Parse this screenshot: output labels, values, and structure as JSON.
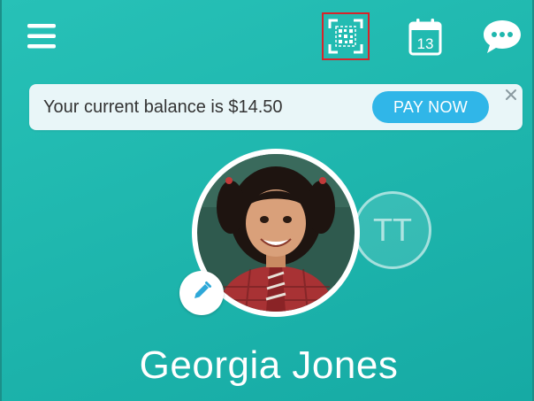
{
  "header": {
    "icons": [
      "menu-icon",
      "qr-scan-icon",
      "calendar-icon",
      "chat-icon"
    ],
    "calendar_day": "13"
  },
  "banner": {
    "message": "Your current balance is $14.50",
    "pay_label": "PAY NOW",
    "close_icon": "close-icon"
  },
  "profile": {
    "name": "Georgia Jones",
    "edit_icon": "pencil-icon",
    "other_initials": "TT"
  },
  "colors": {
    "background": "#1fb7ae",
    "pay_button": "#30b6e8",
    "banner_bg": "#e9f6f8",
    "highlight": "#d7242a"
  }
}
